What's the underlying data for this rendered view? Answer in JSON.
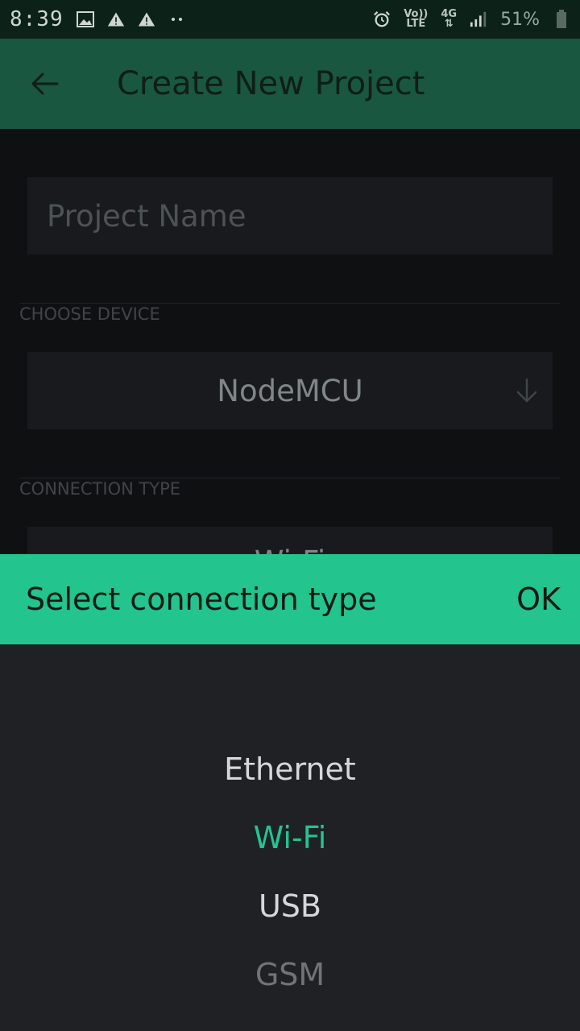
{
  "status_bar": {
    "time": "8:39",
    "network_volte": "Vo))",
    "network_lte": "LTE",
    "network_4g": "4G",
    "battery_text": "51%"
  },
  "app_bar": {
    "title": "Create New Project"
  },
  "form": {
    "project_name_placeholder": "Project Name",
    "project_name_value": "",
    "choose_device_label": "CHOOSE DEVICE",
    "device_value": "NodeMCU",
    "connection_type_label": "CONNECTION TYPE",
    "connection_value": "Wi-Fi"
  },
  "sheet": {
    "title": "Select connection type",
    "ok_label": "OK",
    "options": [
      "Ethernet",
      "Wi-Fi",
      "USB",
      "GSM"
    ],
    "selected": "Wi-Fi"
  },
  "colors": {
    "accent": "#23c48e",
    "app_bar": "#1a5740",
    "status_bar": "#0c2219",
    "background": "#0f1012",
    "picker_background": "#1f2125"
  },
  "icons": [
    "image-icon",
    "warning-icon",
    "overflow-dots-icon",
    "alarm-icon",
    "signal-icon",
    "battery-icon",
    "back-arrow-icon",
    "dropdown-arrow-icon"
  ]
}
